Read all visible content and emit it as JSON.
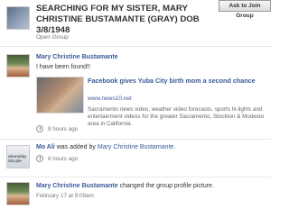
{
  "group": {
    "title": "SEARCHING FOR MY SISTER, MARY CHRISTINE BUSTAMANTE (GRAY) DOB 3/8/1948",
    "type": "Open Group",
    "join_label": "Ask to Join Group"
  },
  "posts": [
    {
      "author": "Mary Christine Bustamante",
      "text": "I have been found!!",
      "share": {
        "title": "Facebook gives Yuba City birth mom a second chance",
        "url": "www.news10.net",
        "description": "Sacramento news video, weather video forecasts, sports hi-lights and entertainment videos for the greater Sacramento, Stockton & Modesto area in California."
      },
      "time": "8 hours ago"
    },
    {
      "author": "Mo Ali",
      "action": "was added by",
      "target": "Mary Christine Bustamante.",
      "time": "8 hours ago",
      "avatar_text": "ationship Sta ple"
    },
    {
      "author": "Mary Christine Bustamante",
      "action": "changed the group profile picture.",
      "time": "February 17 at 9:09am"
    }
  ]
}
